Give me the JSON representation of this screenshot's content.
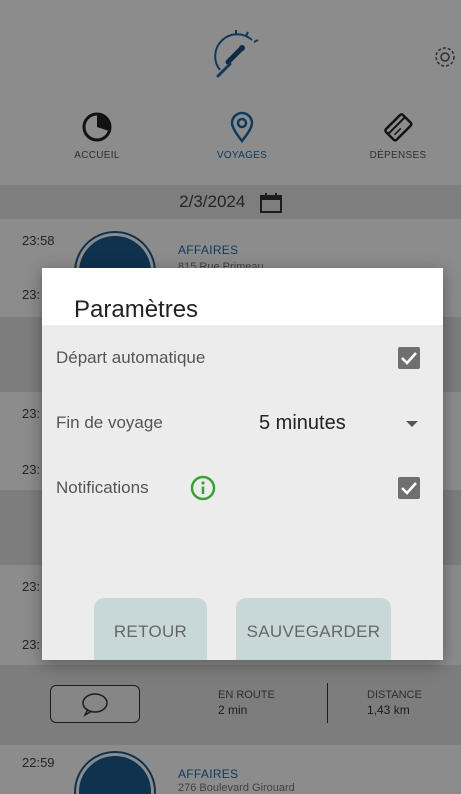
{
  "header": {
    "logo_icon": "speedometer-logo-icon",
    "settings_icon": "gear-icon"
  },
  "nav": {
    "tabs": [
      {
        "label": "ACCUEIL",
        "icon": "pie-chart-icon"
      },
      {
        "label": "VOYAGES",
        "icon": "location-pin-icon"
      },
      {
        "label": "DÉPENSES",
        "icon": "card-icon"
      }
    ],
    "active_index": 1
  },
  "date_bar": {
    "date": "2/3/2024",
    "icon": "calendar-icon"
  },
  "trips": [
    {
      "time_start": "23:58",
      "time_end": "23:",
      "category": "AFFAIRES",
      "address": "815 Rue Primeau"
    },
    {
      "time_start": "23:",
      "time_end": "23:"
    },
    {
      "time_start": "23:",
      "time_end": "23:"
    },
    {
      "time_start": "22:59",
      "category": "AFFAIRES",
      "address": "276 Boulevard Girouard"
    }
  ],
  "stats": {
    "en_route_label": "EN ROUTE",
    "en_route_value": "2 min",
    "distance_label": "DISTANCE",
    "distance_value": "1,43 km"
  },
  "dialog": {
    "title": "Paramètres",
    "auto_depart_label": "Départ automatique",
    "auto_depart_checked": true,
    "end_trip_label": "Fin de voyage",
    "end_trip_value": "5 minutes",
    "notifications_label": "Notifications",
    "notifications_checked": true,
    "info_icon": "info-icon",
    "back_label": "RETOUR",
    "save_label": "SAUVEGARDER"
  },
  "colors": {
    "accent": "#1c5c90",
    "info_green": "#3aa03a",
    "button_bg": "#c8d8d9"
  }
}
